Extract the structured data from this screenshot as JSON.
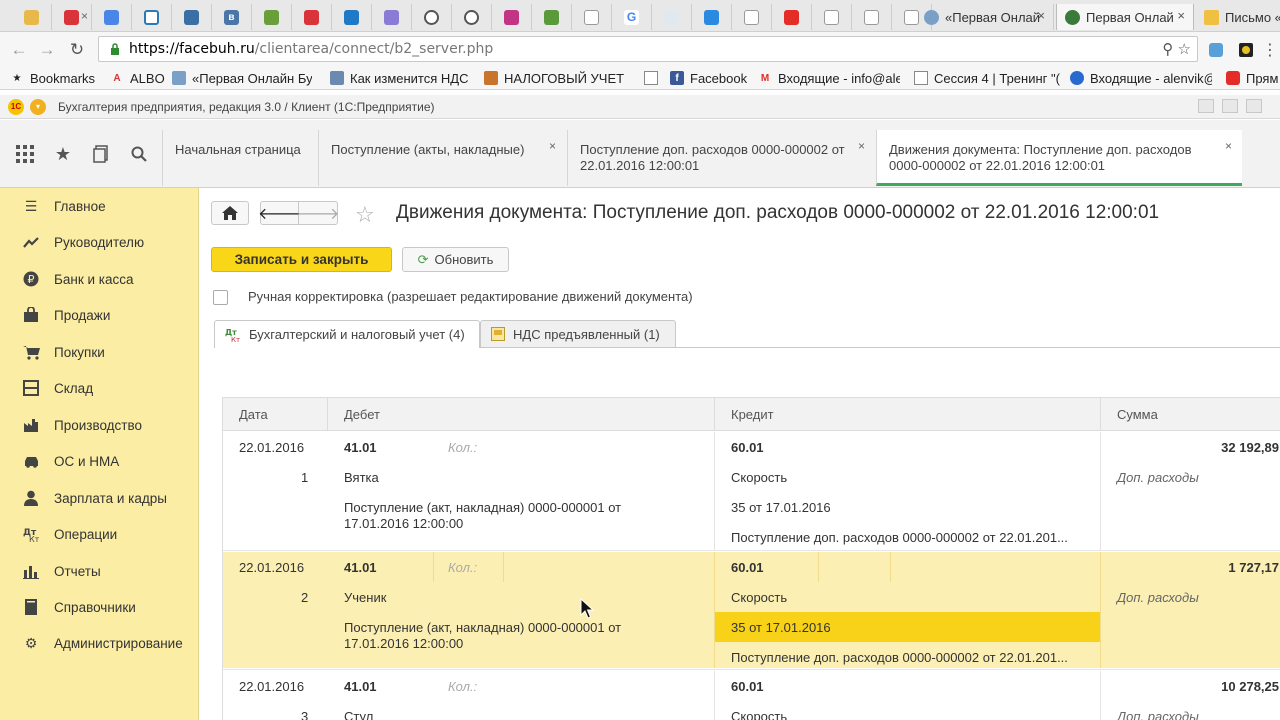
{
  "browser": {
    "tabs": [
      {
        "title": "«Первая Онлай",
        "active": false
      },
      {
        "title": "Первая Онлай",
        "active": true
      },
      {
        "title": "Письмо «",
        "active": false
      }
    ],
    "url_domain": "https://facebuh.ru",
    "url_path": "/clientarea/connect/b2_server.php"
  },
  "bookmarks": [
    {
      "label": "Bookmarks",
      "icon": "star-icon"
    },
    {
      "label": "ALBO",
      "icon": "albo-icon"
    },
    {
      "label": "«Первая Онлайн Бух",
      "icon": "page-icon"
    },
    {
      "label": "Как изменится НДС с",
      "icon": "page-icon"
    },
    {
      "label": "НАЛОГОВЫЙ УЧЕТ Р",
      "icon": "page-icon"
    },
    {
      "label": "",
      "icon": "page-icon"
    },
    {
      "label": "Facebook",
      "icon": "facebook-icon"
    },
    {
      "label": "Входящие - info@ale",
      "icon": "gmail-icon"
    },
    {
      "label": "Сессия 4 | Тренинг \"(",
      "icon": "page-icon"
    },
    {
      "label": "Входящие - alenvik@",
      "icon": "mail-icon"
    },
    {
      "label": "Прям",
      "icon": "youtube-icon"
    }
  ],
  "app": {
    "title": "Бухгалтерия предприятия, редакция 3.0 / Клиент  (1С:Предприятие)"
  },
  "section_tabs": [
    {
      "label": "Начальная страница",
      "closable": false
    },
    {
      "label": "Поступление (акты, накладные)",
      "closable": true
    },
    {
      "label": "Поступление доп. расходов 0000-000002 от 22.01.2016 12:00:01",
      "closable": true
    },
    {
      "label": "Движения документа: Поступление доп. расходов 0000-000002 от 22.01.2016 12:00:01",
      "closable": true,
      "active": true
    }
  ],
  "nav": [
    {
      "label": "Главное",
      "icon": "menu-lines-icon"
    },
    {
      "label": "Руководителю",
      "icon": "trend-icon"
    },
    {
      "label": "Банк и касса",
      "icon": "ruble-icon"
    },
    {
      "label": "Продажи",
      "icon": "bag-icon"
    },
    {
      "label": "Покупки",
      "icon": "cart-icon"
    },
    {
      "label": "Склад",
      "icon": "warehouse-icon"
    },
    {
      "label": "Производство",
      "icon": "factory-icon"
    },
    {
      "label": "ОС и НМА",
      "icon": "car-icon"
    },
    {
      "label": "Зарплата и кадры",
      "icon": "person-icon"
    },
    {
      "label": "Операции",
      "icon": "operations-icon"
    },
    {
      "label": "Отчеты",
      "icon": "chart-icon"
    },
    {
      "label": "Справочники",
      "icon": "book-icon"
    },
    {
      "label": "Администрирование",
      "icon": "gear-icon"
    }
  ],
  "page": {
    "title": "Движения документа: Поступление доп. расходов 0000-000002 от 22.01.2016 12:00:01",
    "save_close": "Записать и закрыть",
    "refresh": "Обновить",
    "manual_edit_label": "Ручная корректировка (разрешает редактирование движений документа)",
    "manual_edit_checked": false,
    "tabs": [
      {
        "label": "Бухгалтерский и налоговый учет (4)",
        "active": true
      },
      {
        "label": "НДС предъявленный (1)",
        "active": false
      }
    ]
  },
  "grid": {
    "columns": [
      "Дата",
      "Дебет",
      "Кредит",
      "Сумма"
    ],
    "records": [
      {
        "date": "22.01.2016",
        "num": "1",
        "debit": "41.01",
        "debit_qty": "Кол.:",
        "debit_sub1": "Вятка",
        "debit_sub2": "Поступление (акт, накладная) 0000-000001 от",
        "debit_sub2b": "17.01.2016 12:00:00",
        "credit": "60.01",
        "credit_sub1": "Скорость",
        "credit_sub2": "35 от 17.01.2016",
        "credit_sub3": "Поступление доп. расходов 0000-000002 от 22.01.201...",
        "sum": "32 192,89",
        "sum_note": "Доп. расходы",
        "selected": false
      },
      {
        "date": "22.01.2016",
        "num": "2",
        "debit": "41.01",
        "debit_qty": "Кол.:",
        "debit_sub1": "Ученик",
        "debit_sub2": "Поступление (акт, накладная) 0000-000001 от",
        "debit_sub2b": "17.01.2016 12:00:00",
        "credit": "60.01",
        "credit_sub1": "Скорость",
        "credit_sub2": "35 от 17.01.2016",
        "credit_sub3": "Поступление доп. расходов 0000-000002 от 22.01.201...",
        "sum": "1 727,17",
        "sum_note": "Доп. расходы",
        "selected": true
      },
      {
        "date": "22.01.2016",
        "num": "3",
        "debit": "41.01",
        "debit_qty": "Кол.:",
        "debit_sub1": "Стул",
        "credit": "60.01",
        "credit_sub1": "Скорость",
        "sum": "10 278,25",
        "sum_note": "Доп. расходы",
        "selected": false
      }
    ]
  },
  "colors": {
    "accent_yellow": "#fad619",
    "nav_bg": "#fbeda4",
    "selected_row": "#fcefb4",
    "selected_cell": "#f7d219",
    "active_tab_line": "#41a85f"
  }
}
